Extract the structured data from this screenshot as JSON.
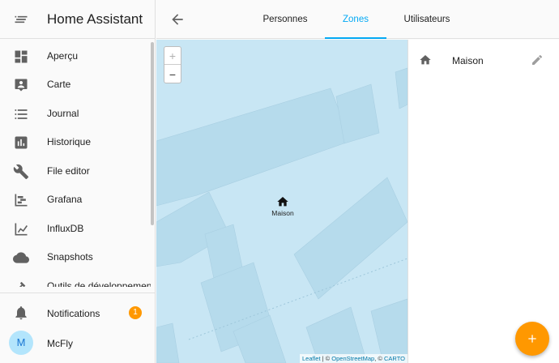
{
  "app": {
    "title": "Home Assistant"
  },
  "sidebar": {
    "items": [
      {
        "label": "Aperçu",
        "icon": "dashboard-icon"
      },
      {
        "label": "Carte",
        "icon": "map-account-icon"
      },
      {
        "label": "Journal",
        "icon": "list-icon"
      },
      {
        "label": "Historique",
        "icon": "bar-chart-icon"
      },
      {
        "label": "File editor",
        "icon": "wrench-icon"
      },
      {
        "label": "Grafana",
        "icon": "chart-timeline-icon"
      },
      {
        "label": "InfluxDB",
        "icon": "chart-line-icon"
      },
      {
        "label": "Snapshots",
        "icon": "cloud-icon"
      },
      {
        "label": "Outils de développement",
        "icon": "hammer-icon"
      }
    ],
    "notifications": {
      "label": "Notifications",
      "count": "1"
    },
    "user": {
      "initial": "M",
      "name": "McFly"
    }
  },
  "tabs": [
    {
      "label": "Personnes",
      "active": false
    },
    {
      "label": "Zones",
      "active": true
    },
    {
      "label": "Utilisateurs",
      "active": false
    }
  ],
  "map": {
    "zoom_in": "+",
    "zoom_out": "−",
    "marker_label": "Maison",
    "attribution": {
      "leaflet": "Leaflet",
      "osm": "OpenStreetMap",
      "carto": "CARTO"
    }
  },
  "zones": [
    {
      "name": "Maison",
      "icon": "home-icon"
    }
  ],
  "colors": {
    "accent": "#03a9f4",
    "fab": "#ff9800",
    "map_water": "#c8e6f4",
    "map_building": "#b3d9ea"
  }
}
